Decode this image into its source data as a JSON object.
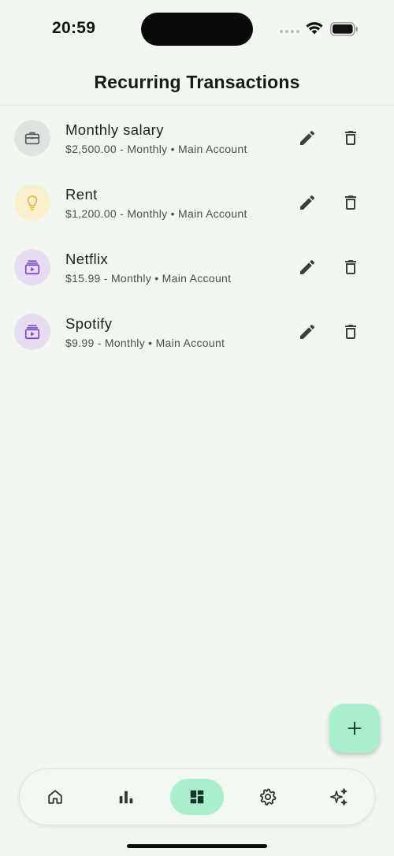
{
  "status_bar": {
    "time": "20:59"
  },
  "header": {
    "title": "Recurring Transactions"
  },
  "transactions": [
    {
      "name": "Monthly salary",
      "subtitle": "$2,500.00 - Monthly • Main Account",
      "icon": "briefcase-icon",
      "icon_color": "#4f5b58",
      "avatar_bg": "#dfe4e1"
    },
    {
      "name": "Rent",
      "subtitle": "$1,200.00 - Monthly • Main Account",
      "icon": "lightbulb-icon",
      "icon_color": "#e5b93c",
      "avatar_bg": "#f8efcc"
    },
    {
      "name": "Netflix",
      "subtitle": "$15.99 - Monthly • Main Account",
      "icon": "subscriptions-icon",
      "icon_color": "#7b48c9",
      "avatar_bg": "#e6ddf1"
    },
    {
      "name": "Spotify",
      "subtitle": "$9.99 - Monthly • Main Account",
      "icon": "subscriptions-icon",
      "icon_color": "#7b48c9",
      "avatar_bg": "#e6ddf1"
    }
  ],
  "row_actions": {
    "edit_icon": "pencil-icon",
    "delete_icon": "trash-icon"
  },
  "fab": {
    "icon": "plus-icon",
    "bg": "#a9efcd"
  },
  "bottom_nav": {
    "active_index": 2,
    "items": [
      {
        "icon": "home-icon"
      },
      {
        "icon": "bar-chart-icon"
      },
      {
        "icon": "dashboard-icon"
      },
      {
        "icon": "gear-icon"
      },
      {
        "icon": "sparkles-icon"
      }
    ]
  },
  "colors": {
    "background": "#f2f8f1",
    "accent": "#a9efcd",
    "action_icon": "#3d413e"
  }
}
